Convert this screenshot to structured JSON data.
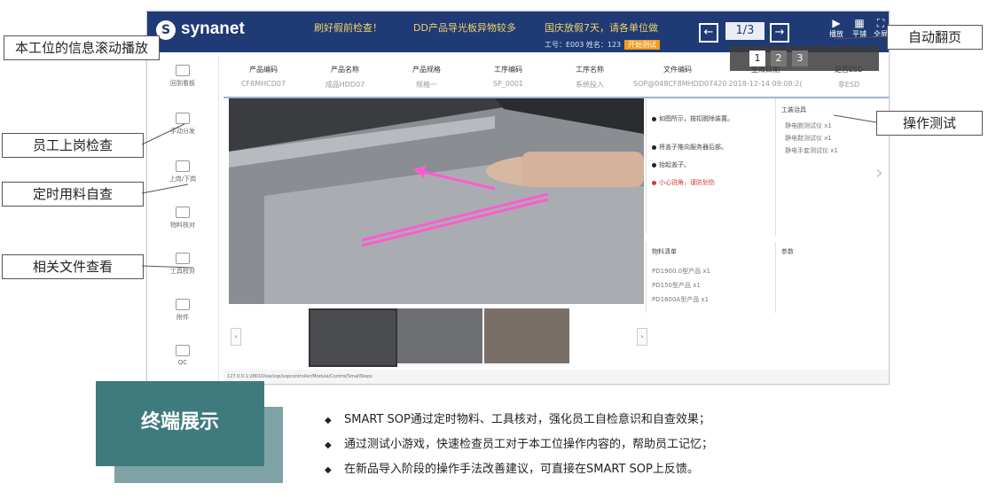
{
  "app": {
    "logo": "synanet",
    "ticker": [
      "刷好假前检查！",
      "DD产品导光板异物较多",
      "国庆放假7天，请各单位做"
    ],
    "meta": {
      "employee": "工号：E003  姓名：123",
      "badge": "开始测试"
    },
    "pager": "1/3",
    "tools": [
      "播放",
      "平铺",
      "全屏"
    ]
  },
  "header_cols": [
    {
      "key": "产品编码",
      "value": "CF8MHCD07"
    },
    {
      "key": "产品名称",
      "value": "成品HDD07"
    },
    {
      "key": "产品规格",
      "value": "规格一"
    },
    {
      "key": "工序编码",
      "value": "SP_0001"
    },
    {
      "key": "工序名称",
      "value": "系统投入"
    },
    {
      "key": "文件编码",
      "value": "SOP@048CF8MHDD07420"
    },
    {
      "key": "生效日期",
      "value": "2018-12-14 09:08:2("
    },
    {
      "key": "是否ESD",
      "value": "非ESD"
    }
  ],
  "sidebar": [
    {
      "label": "回到看板"
    },
    {
      "label": "手动分发"
    },
    {
      "label": "上岗/下岗"
    },
    {
      "label": "物料核对"
    },
    {
      "label": "工具校对"
    },
    {
      "label": "附件"
    },
    {
      "label": "QC"
    }
  ],
  "instructions": [
    {
      "text": "如图所示，按扣脱除装置。",
      "warn": false
    },
    {
      "text": "将盖子推向服务器后部。",
      "warn": false
    },
    {
      "text": "抬起盖子。",
      "warn": false
    },
    {
      "text": "小心锐角，谨防划伤",
      "warn": true
    }
  ],
  "materials": {
    "title": "物料清单",
    "items": [
      "PD1900.0型产品  x1",
      "PD150型产品  x1",
      "PD1600A型产品  x1"
    ]
  },
  "tools_panel": {
    "title": "工装治具",
    "items": [
      "静电腕测试仪  x1",
      "静电鞋测试仪  x1",
      "静电手套测试仪  x1"
    ]
  },
  "params_title": "参数",
  "status_bar": "127.0.0.1:28010/sw/sop/sopcontroller/Module/Control/SmallSteps",
  "page_strip": [
    "1",
    "2",
    "3"
  ],
  "callouts": {
    "info_scroll": "本工位的信息滚动播放",
    "checkin": "员工上岗检查",
    "material_check": "定时用料自查",
    "docs": "相关文件查看",
    "auto_page": "自动翻页",
    "op_test": "操作测试"
  },
  "bottom": {
    "title": "终端展示",
    "bullets": [
      "SMART SOP通过定时物料、工具核对，强化员工自检意识和自查效果；",
      "通过测试小游戏，快速检查员工对于本工位操作内容的，帮助员工记忆；",
      "在新品导入阶段的操作手法改善建议，可直接在SMART SOP上反馈。"
    ]
  },
  "colors": {
    "topbar": "#1f3a74",
    "ticker": "#f3d36a",
    "teal": "#3f7b7e",
    "teal_light": "#7fa3a4",
    "warn": "#d43c2b"
  }
}
